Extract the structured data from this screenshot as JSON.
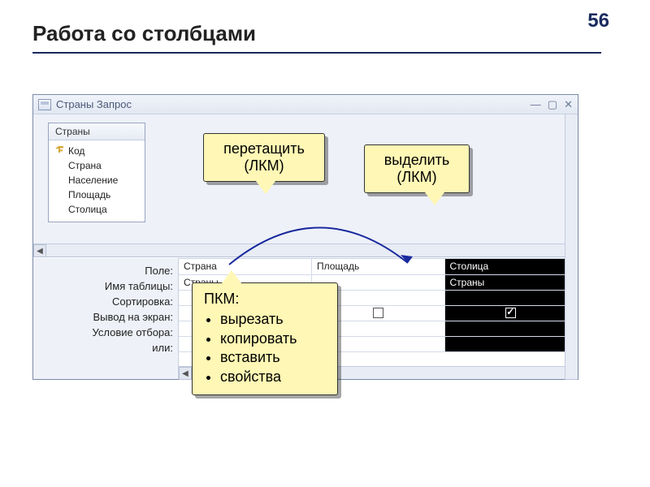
{
  "page_number": "56",
  "title": "Работа со столбцами",
  "window": {
    "title": "Страны Запрос"
  },
  "table": {
    "name": "Страны",
    "fields": [
      "Код",
      "Страна",
      "Население",
      "Площадь",
      "Столица"
    ]
  },
  "row_labels": [
    "Поле:",
    "Имя таблицы:",
    "Сортировка:",
    "Вывод на экран:",
    "Условие отбора:",
    "или:"
  ],
  "columns": [
    {
      "field": "Страна",
      "table": "Страны",
      "show": true,
      "selected": false
    },
    {
      "field": "Площадь",
      "table": "",
      "show": false,
      "selected": false
    },
    {
      "field": "Столица",
      "table": "Страны",
      "show": true,
      "selected": true
    }
  ],
  "callouts": {
    "drag": {
      "line1": "перетащить",
      "line2": "(ЛКМ)"
    },
    "select": {
      "line1": "выделить",
      "line2": "(ЛКМ)"
    },
    "context": {
      "title": "ПКМ:",
      "items": [
        "вырезать",
        "копировать",
        "вставить",
        "свойства"
      ]
    }
  }
}
